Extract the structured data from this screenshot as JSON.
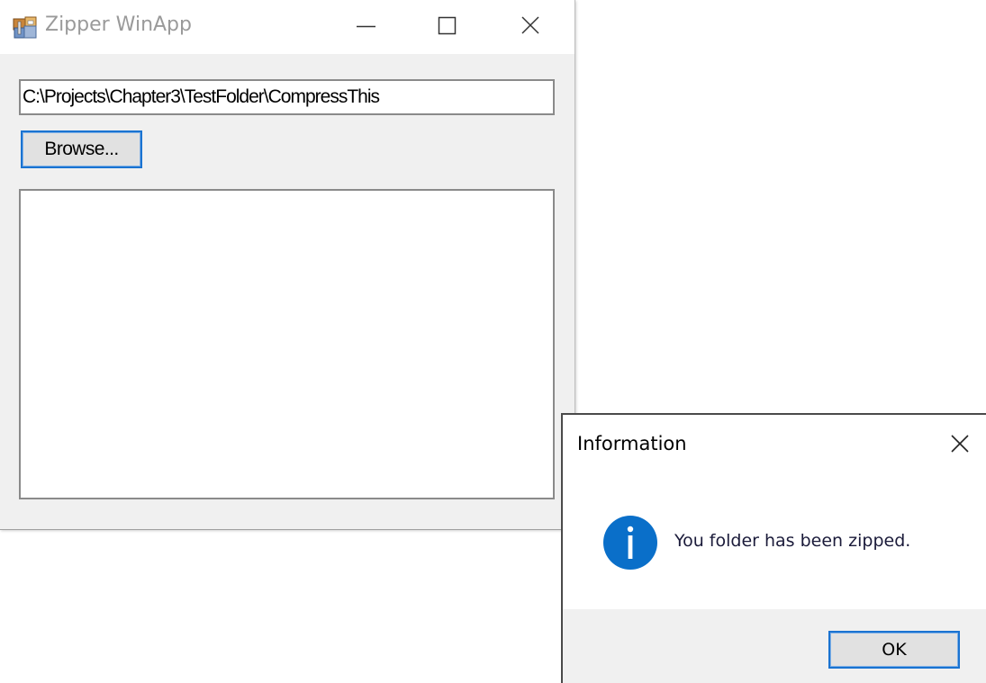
{
  "main_window": {
    "title": "Zipper WinApp",
    "app_icon": "zipper-app-icon",
    "caption_buttons": {
      "minimize_icon": "minimize-icon",
      "maximize_icon": "maximize-icon",
      "close_icon": "close-icon"
    },
    "path_input": {
      "value": "C:\\Projects\\Chapter3\\TestFolder\\CompressThis"
    },
    "browse_button": {
      "label": "Browse..."
    },
    "output_box": {
      "content": ""
    }
  },
  "message_box": {
    "title": "Information",
    "close_icon": "close-icon",
    "icon": "info-icon",
    "message": "You folder has been zipped.",
    "ok_button": {
      "label": "OK"
    }
  },
  "colors": {
    "accent": "#1a73d1",
    "info_icon": "#0a6fc9",
    "window_bg": "#f0f0f0",
    "button_bg": "#e1e1e1",
    "title_text": "#9a9a9a"
  }
}
